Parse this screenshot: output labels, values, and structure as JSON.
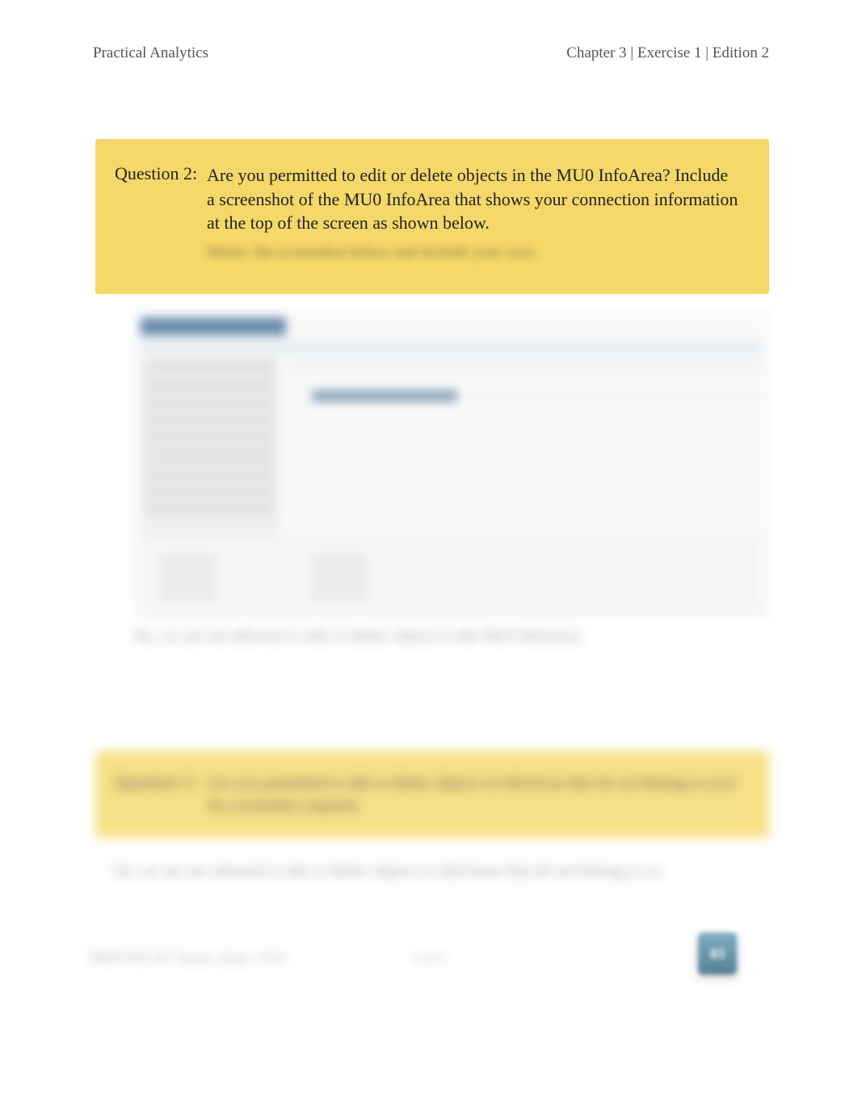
{
  "header": {
    "left": "Practical Analytics",
    "right": "Chapter 3 | Exercise 1 | Edition 2"
  },
  "question2": {
    "label": "Question 2:",
    "text": "Are you permitted to edit or delete objects in the MU0 InfoArea? Include a screenshot of the MU0 InfoArea that shows your connection information at the top of the screen as shown below.",
    "sub": "Mimic the screenshot below and include your own."
  },
  "answer2_blur": "No, we are not allowed to edit or delete objects in the MU0 InfoArea.",
  "question3": {
    "label": "Question 3:",
    "text": "Are you permitted to edit or delete objects in InfoAreas that do not belong to you?        No screenshot required."
  },
  "answer3_blur": "No, we are not allowed to edit or delete objects in InfoAreas that do not belong to us.",
  "footer": {
    "left": "PRINTED BY Name | Date | TOC",
    "center": "1 of 1"
  },
  "badge": "03"
}
